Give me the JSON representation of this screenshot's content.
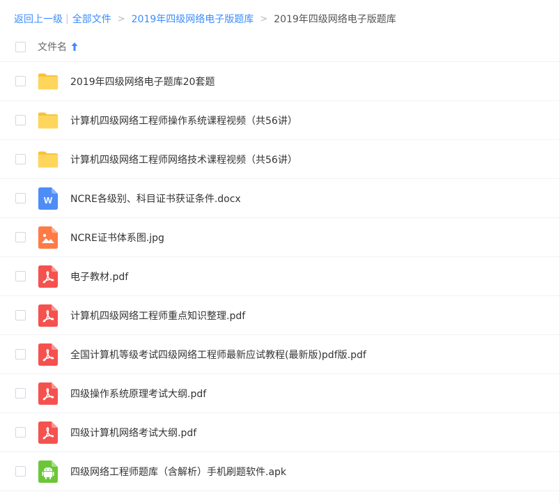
{
  "breadcrumb": {
    "back_label": "返回上一级",
    "all_files_label": "全部文件",
    "folder_link_label": "2019年四级网络电子版题库",
    "current_label": "2019年四级网络电子版题库"
  },
  "list_header": {
    "column_label": "文件名"
  },
  "files": [
    {
      "name": "2019年四级网络电子题库20套题",
      "icon": "folder-icon"
    },
    {
      "name": "计算机四级网络工程师操作系统课程视频（共56讲）",
      "icon": "folder-icon"
    },
    {
      "name": "计算机四级网络工程师网络技术课程视频（共56讲）",
      "icon": "folder-icon"
    },
    {
      "name": "NCRE各级别、科目证书获证条件.docx",
      "icon": "word-icon"
    },
    {
      "name": "NCRE证书体系图.jpg",
      "icon": "image-icon"
    },
    {
      "name": "电子教材.pdf",
      "icon": "pdf-icon"
    },
    {
      "name": "计算机四级网络工程师重点知识整理.pdf",
      "icon": "pdf-icon"
    },
    {
      "name": "全国计算机等级考试四级网络工程师最新应试教程(最新版)pdf版.pdf",
      "icon": "pdf-icon"
    },
    {
      "name": "四级操作系统原理考试大纲.pdf",
      "icon": "pdf-icon"
    },
    {
      "name": "四级计算机网络考试大纲.pdf",
      "icon": "pdf-icon"
    },
    {
      "name": "四级网络工程师题库（含解析）手机刷题软件.apk",
      "icon": "android-icon"
    }
  ],
  "colors": {
    "link": "#3b8cff",
    "folder": "#ffd257",
    "word": "#4e8cf7",
    "image": "#ff7b45",
    "pdf": "#f5524f",
    "android": "#6cc738"
  }
}
